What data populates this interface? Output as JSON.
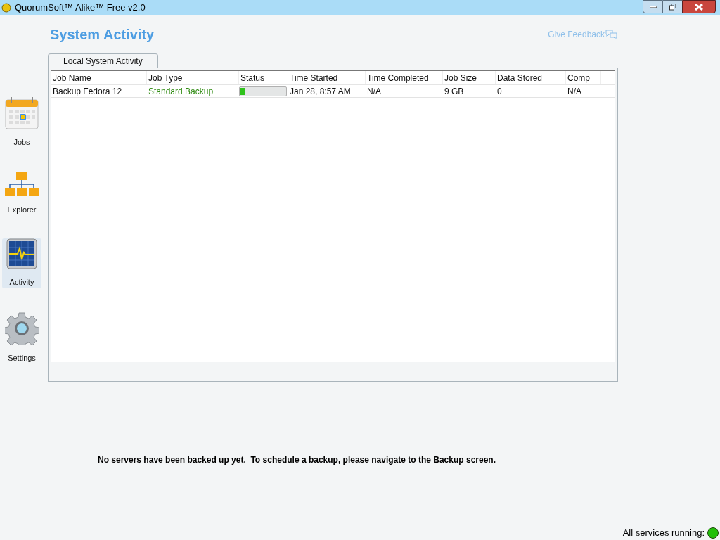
{
  "window": {
    "title": "QuorumSoft™ Alike™ Free v2.0"
  },
  "sidebar": {
    "items": [
      {
        "label": "Jobs",
        "kind": "calendar",
        "selected": false
      },
      {
        "label": "Explorer",
        "kind": "folders",
        "selected": false
      },
      {
        "label": "Activity",
        "kind": "monitor",
        "selected": true
      },
      {
        "label": "Settings",
        "kind": "gear",
        "selected": false
      }
    ]
  },
  "page_title": "System Activity",
  "feedback_link": "Give Feedback",
  "tabs": [
    {
      "label": "Local System Activity",
      "selected": true
    }
  ],
  "table": {
    "columns": [
      "Job Name",
      "Job Type",
      "Status",
      "Time Started",
      "Time Completed",
      "Job Size",
      "Data Stored",
      "Comp"
    ],
    "rows": [
      {
        "job_name": "Backup Fedora 12",
        "job_type": "Standard Backup",
        "status": {
          "level": 0.1
        },
        "time_started": "Jan 28, 8:57 AM",
        "time_completed": "N/A",
        "job_size": "9 GB",
        "data_stored": "0",
        "comp": "N/A"
      }
    ]
  },
  "message": "No servers have been backed up yet.  To schedule a backup, please navigate to the Backup screen.",
  "status_bar": {
    "text": "All services running:",
    "color": "#22c00a"
  }
}
